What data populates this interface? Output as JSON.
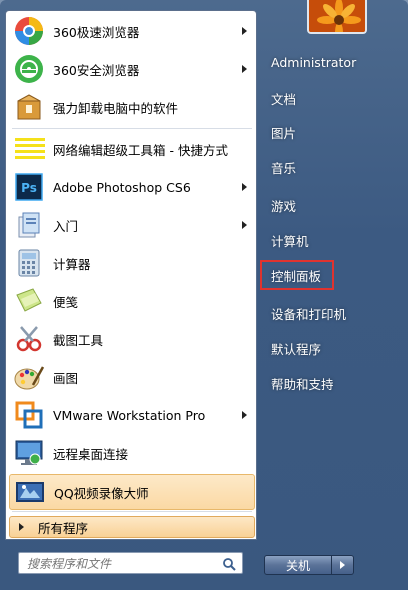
{
  "left_menu": {
    "items": [
      {
        "label": "360极速浏览器",
        "icon": "360-speed-browser-icon",
        "submenu": true
      },
      {
        "label": "360安全浏览器",
        "icon": "360-safe-browser-icon",
        "submenu": true
      },
      {
        "label": "强力卸载电脑中的软件",
        "icon": "uninstaller-icon",
        "submenu": false
      },
      {
        "label": "网络编辑超级工具箱 - 快捷方式",
        "icon": "toolbox-shortcut-icon",
        "submenu": false
      },
      {
        "label": "Adobe Photoshop CS6",
        "icon": "photoshop-icon",
        "submenu": true
      },
      {
        "label": "入门",
        "icon": "getting-started-icon",
        "submenu": true
      },
      {
        "label": "计算器",
        "icon": "calculator-icon",
        "submenu": false
      },
      {
        "label": "便笺",
        "icon": "sticky-notes-icon",
        "submenu": false
      },
      {
        "label": "截图工具",
        "icon": "snipping-tool-icon",
        "submenu": false
      },
      {
        "label": "画图",
        "icon": "paint-icon",
        "submenu": false
      },
      {
        "label": "VMware Workstation Pro",
        "icon": "vmware-icon",
        "submenu": true
      },
      {
        "label": "远程桌面连接",
        "icon": "remote-desktop-icon",
        "submenu": false
      },
      {
        "label": "QQ视频录像大师",
        "icon": "qq-video-recorder-icon",
        "submenu": false,
        "highlighted": true
      }
    ],
    "all_programs": "所有程序",
    "search_placeholder": "搜索程序和文件"
  },
  "right_menu": {
    "items": [
      {
        "label": "Administrator"
      },
      {
        "label": "文档"
      },
      {
        "label": "图片"
      },
      {
        "label": "音乐"
      },
      {
        "label": "游戏"
      },
      {
        "label": "计算机"
      },
      {
        "label": "控制面板",
        "highlighted_box": true
      },
      {
        "label": "设备和打印机"
      },
      {
        "label": "默认程序"
      },
      {
        "label": "帮助和支持"
      }
    ],
    "shutdown_label": "关机"
  },
  "colors": {
    "highlight_box": "#e0332f",
    "panel_bg": "#3c5a82",
    "hover_bg": "#fbd9a4"
  }
}
